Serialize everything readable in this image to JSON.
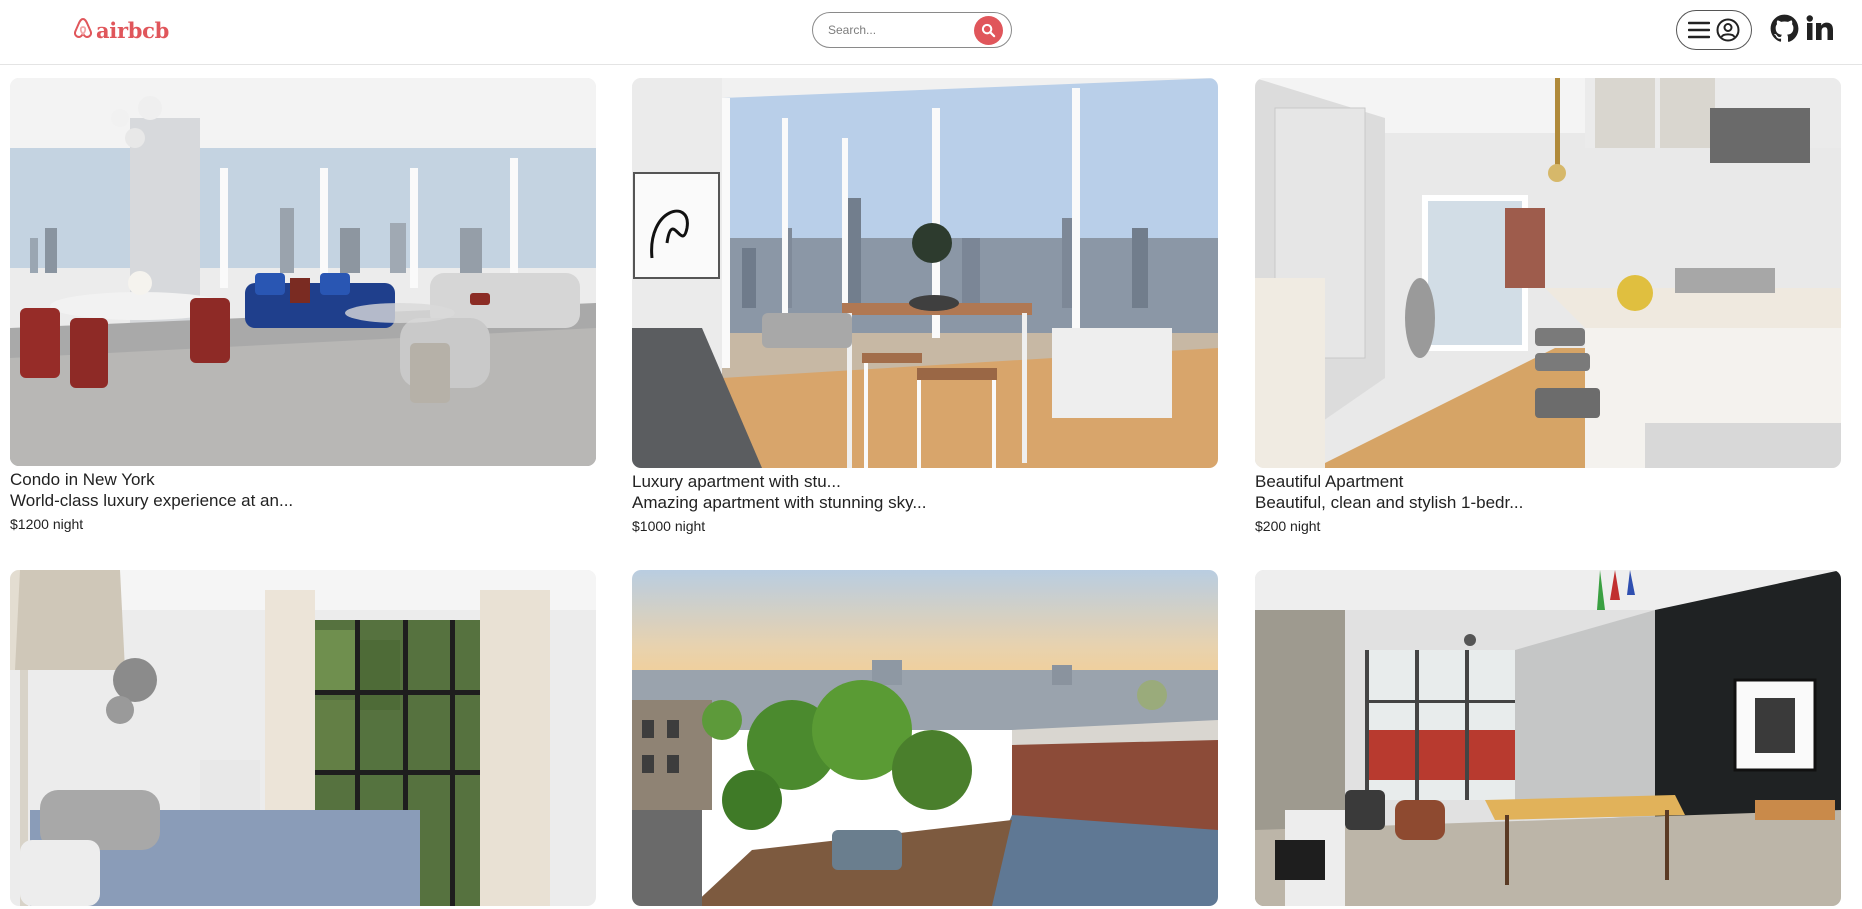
{
  "brand": {
    "name": "airbcb",
    "color": "#e0565b"
  },
  "search": {
    "placeholder": "Search..."
  },
  "header": {
    "menu_icon": "hamburger-icon",
    "user_icon": "user-circle-icon",
    "social": [
      "github-icon",
      "linkedin-icon"
    ]
  },
  "listings": [
    {
      "title": "Condo in New York",
      "description": "World-class luxury experience at an...",
      "price": "$1200",
      "price_unit": "night"
    },
    {
      "title": "Luxury apartment with stu...",
      "description": "Amazing apartment with stunning sky...",
      "price": "$1000",
      "price_unit": "night"
    },
    {
      "title": "Beautiful Apartment",
      "description": "Beautiful, clean and stylish 1-bedr...",
      "price": "$200",
      "price_unit": "night"
    },
    {
      "title": "",
      "description": "",
      "price": "",
      "price_unit": ""
    },
    {
      "title": "",
      "description": "",
      "price": "",
      "price_unit": ""
    },
    {
      "title": "",
      "description": "",
      "price": "",
      "price_unit": ""
    }
  ]
}
